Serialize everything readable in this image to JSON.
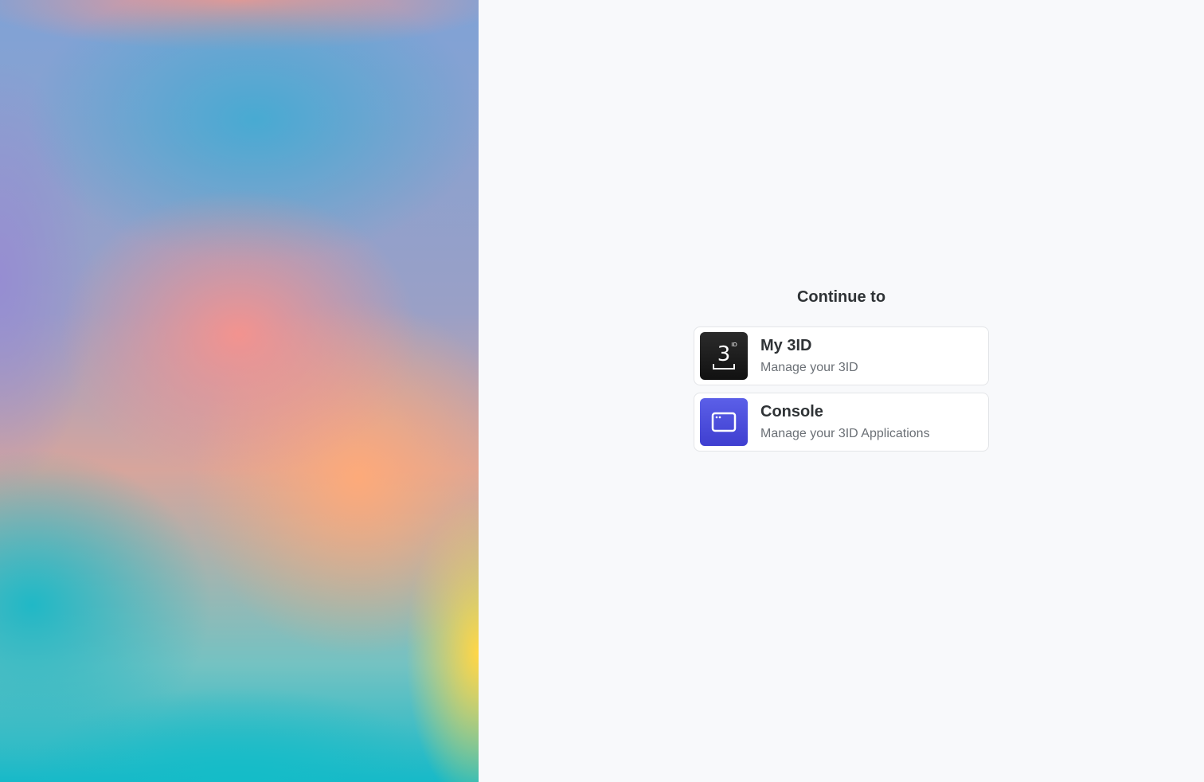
{
  "heading": "Continue to",
  "options": [
    {
      "title": "My 3ID",
      "subtitle": "Manage your 3ID",
      "icon": "3id-logo-icon"
    },
    {
      "title": "Console",
      "subtitle": "Manage your 3ID Applications",
      "icon": "browser-window-icon"
    }
  ],
  "colors": {
    "background": "#f8f9fb",
    "console_icon": "#4f50dd",
    "my3id_icon": "#1c1c1c"
  }
}
